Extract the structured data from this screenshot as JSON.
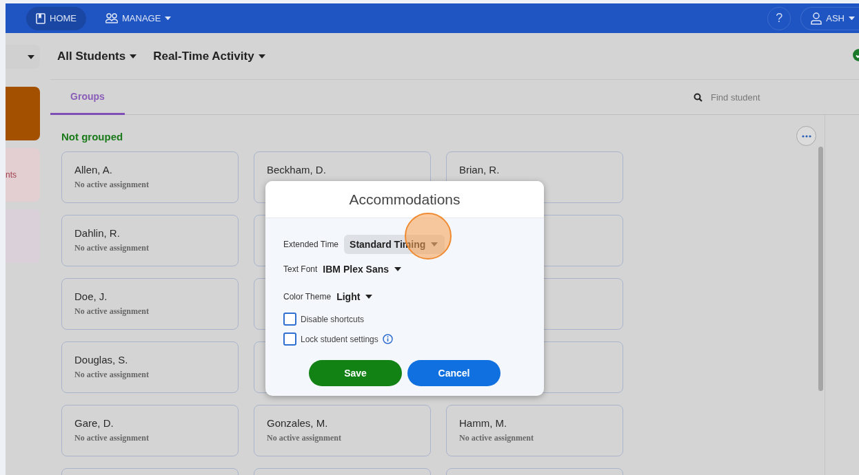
{
  "topbar": {
    "nav": [
      {
        "label": "HOME",
        "selected": true,
        "dropdown": false
      },
      {
        "label": "MANAGE",
        "selected": false,
        "dropdown": true
      }
    ],
    "help": "?",
    "user": "ASH"
  },
  "filters": [
    "All Students",
    "Real-Time Activity"
  ],
  "sidebar": {
    "cards": [
      {
        "color": "#a35000"
      },
      {
        "color": "#e3cfd2",
        "text": "nts"
      },
      {
        "color": "#d9d0d9"
      }
    ]
  },
  "tabs": [
    {
      "label": "Groups",
      "selected": true
    }
  ],
  "search": {
    "placeholder": "Find student"
  },
  "section_title": "Not grouped",
  "cards": [
    {
      "kind": "student",
      "name": "Allen, A.",
      "status": "No active assignment"
    },
    {
      "kind": "student",
      "name": "Beckham, D."
    },
    {
      "kind": "student",
      "name": "Brian, R."
    },
    {
      "kind": "student",
      "name": "Dahlin, R.",
      "status": "No active assignment"
    },
    {
      "kind": "blank"
    },
    {
      "kind": "blank"
    },
    {
      "kind": "student",
      "name": "Doe, J.",
      "status": "No active assignment"
    },
    {
      "kind": "blank"
    },
    {
      "kind": "blank"
    },
    {
      "kind": "student",
      "name": "Douglas, S.",
      "status": "No active assignment"
    },
    {
      "kind": "blank"
    },
    {
      "kind": "blank"
    },
    {
      "kind": "student",
      "name": "Gare, D.",
      "status": "No active assignment"
    },
    {
      "kind": "student",
      "name": "Gonzales, M.",
      "status": "No active assignment"
    },
    {
      "kind": "student",
      "name": "Hamm, M.",
      "status": "No active assignment"
    },
    {
      "kind": "blank"
    },
    {
      "kind": "blank"
    },
    {
      "kind": "blank"
    }
  ],
  "dialog": {
    "title": "Accommodations",
    "fields": [
      {
        "label": "Extended Time",
        "value": "Standard Timing",
        "focused": true
      },
      {
        "label": "Text Font",
        "value": "IBM Plex Sans",
        "focused": false
      },
      {
        "label": "Color Theme",
        "value": "Light",
        "focused": false
      }
    ],
    "checkboxes": [
      {
        "label": "Disable shortcuts",
        "checked": false,
        "info": false
      },
      {
        "label": "Lock student settings",
        "checked": false,
        "info": true
      }
    ],
    "buttons": [
      {
        "label": "Save",
        "kind": "primary"
      },
      {
        "label": "Cancel",
        "kind": "secondary"
      }
    ]
  }
}
